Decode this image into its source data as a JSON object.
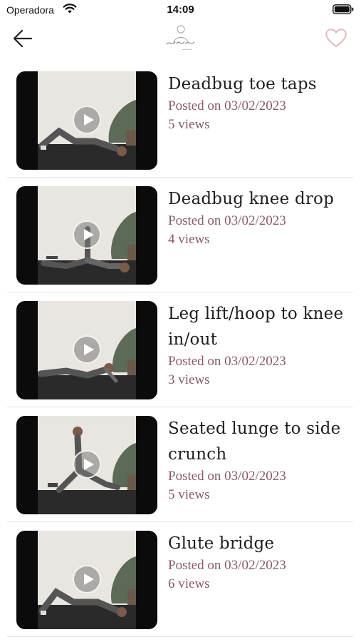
{
  "status_bar": {
    "carrier": "Operadora",
    "time": "14:09"
  },
  "nav": {
    "back_icon": "arrow-left-icon",
    "logo": "brand-logo",
    "favorite_icon": "heart-outline-icon",
    "accent_color": "#e4b8b8"
  },
  "videos": [
    {
      "title": "Deadbug toe taps",
      "posted": "Posted on 03/02/2023",
      "views": "5 views"
    },
    {
      "title": "Deadbug knee drop",
      "posted": "Posted on 03/02/2023",
      "views": "4 views"
    },
    {
      "title": "Leg lift/hoop to knee in/out",
      "posted": "Posted on 03/02/2023",
      "views": "3 views"
    },
    {
      "title": "Seated lunge to side crunch",
      "posted": "Posted on 03/02/2023",
      "views": "5 views"
    },
    {
      "title": "Glute bridge",
      "posted": "Posted on 03/02/2023",
      "views": "6 views"
    }
  ],
  "meta_color": "#8a5a66"
}
